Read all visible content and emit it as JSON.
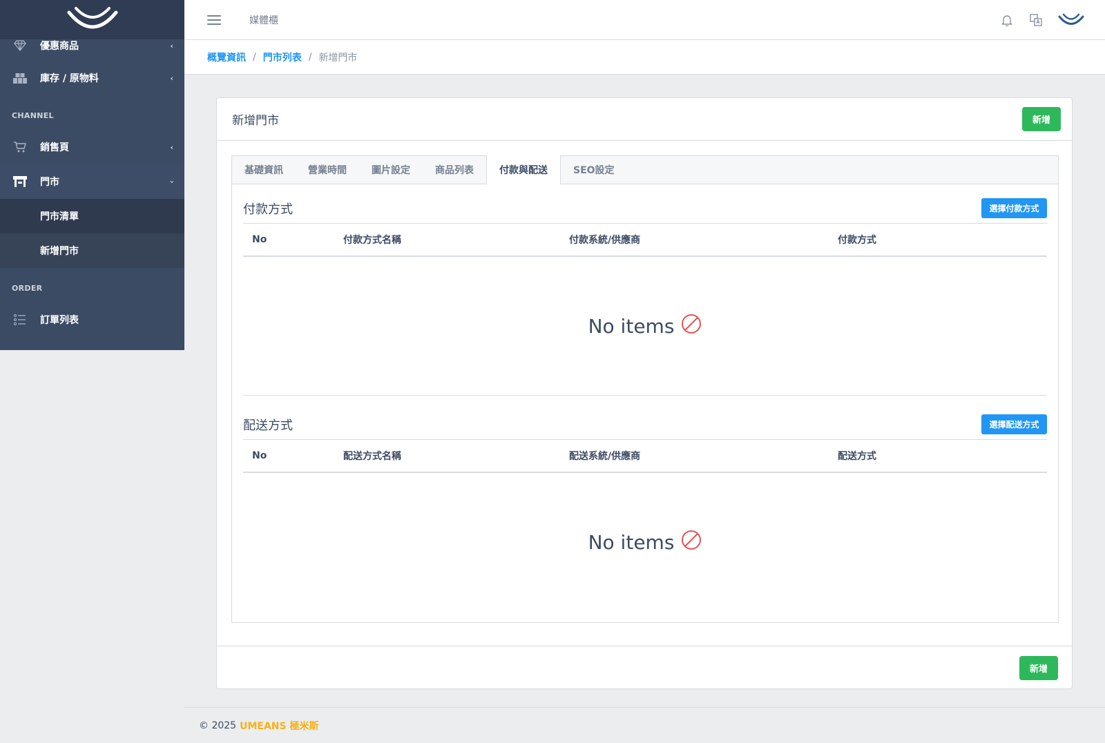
{
  "sidebar": {
    "items_top": [
      {
        "label": "優惠商品",
        "icon": "diamond-icon"
      },
      {
        "label": "庫存 / 原物料",
        "icon": "inventory-icon"
      }
    ],
    "section_channel": "CHANNEL",
    "channel_items": [
      {
        "label": "銷售頁",
        "icon": "cart-icon"
      },
      {
        "label": "門市",
        "icon": "store-icon"
      }
    ],
    "store_children": [
      "門市清單",
      "新增門市"
    ],
    "section_order": "ORDER",
    "order_items": [
      {
        "label": "訂單列表",
        "icon": "list-icon"
      }
    ]
  },
  "header": {
    "link": "媒體櫃"
  },
  "breadcrumb": {
    "items": [
      "概覽資訊",
      "門市列表",
      "新增門市"
    ]
  },
  "card": {
    "title": "新增門市",
    "add_label": "新增",
    "tabs": [
      "基礎資訊",
      "營業時間",
      "圖片設定",
      "商品列表",
      "付款與配送",
      "SEO設定"
    ],
    "active_tab": "付款與配送"
  },
  "payment": {
    "title": "付款方式",
    "select_label": "選擇付款方式",
    "columns": [
      "No",
      "付款方式名稱",
      "付款系統/供應商",
      "付款方式"
    ],
    "empty": "No items"
  },
  "shipping": {
    "title": "配送方式",
    "select_label": "選擇配送方式",
    "columns": [
      "No",
      "配送方式名稱",
      "配送系統/供應商",
      "配送方式"
    ],
    "empty": "No items"
  },
  "footer": {
    "copyright": "© 2025",
    "brand": "UMEANS 極米斯"
  },
  "colors": {
    "sidebar": "#3c4b64",
    "success": "#2eb85c",
    "info": "#2196f3",
    "danger": "#e55353",
    "brand": "#f9b115"
  }
}
